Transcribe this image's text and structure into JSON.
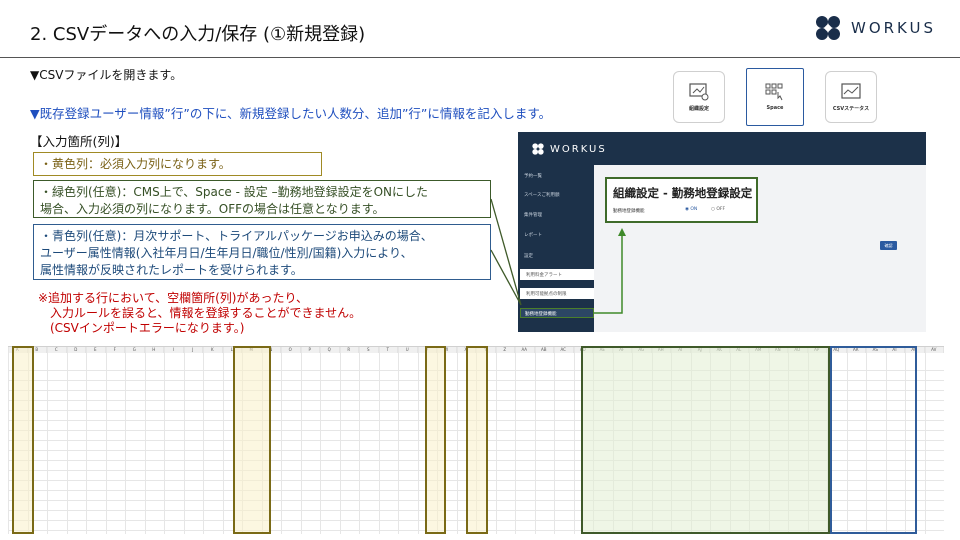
{
  "slide": {
    "title": "2. CSVデータへの入力/保存 (①新規登録)",
    "logo_text": "WORKUS"
  },
  "instructions": {
    "line1": "▼CSVファイルを開きます。",
    "line2": "▼既存登録ユーザー情報”行”の下に、新規登録したい人数分、追加”行”に情報を記入します。",
    "section_label": "【入力箇所(列)】"
  },
  "legend": {
    "yellow": "・黄色列：必須入力列になります。",
    "green": [
      "・緑色列(任意)：CMS上で、Space - 設定 –勤務地登録設定をONにした",
      "場合、入力必須の列になります。OFFの場合は任意となります。"
    ],
    "blue": [
      "・青色列(任意)：月次サポート、トライアルパッケージお申込みの場合、",
      "ユーザー属性情報(入社年月日/生年月日/職位/性別/国籍)入力により、",
      "属性情報が反映されたレポートを受けられます。"
    ]
  },
  "note": [
    "※追加する行において、空欄箇所(列)があったり、",
    "　入力ルールを誤ると、情報を登録することができません。",
    "　(CSVインポートエラーになります。)"
  ],
  "menu_icons": [
    {
      "label": "組織設定",
      "icon": "org-settings-icon",
      "selected": false
    },
    {
      "label": "Space",
      "icon": "space-icon",
      "selected": true
    },
    {
      "label": "CSVステータス",
      "icon": "csv-status-icon",
      "selected": false
    }
  ],
  "screenshot": {
    "logo_text": "WORKUS",
    "sidebar": [
      "予約一覧",
      "スペースご利用額",
      "集件管理",
      "レポート",
      "設定"
    ],
    "sub_items": [
      "利用料金アラート",
      "利用可能拠点の制限"
    ],
    "active_item": "勤務地登録機能",
    "heading": "組織設定 - 勤務地登録設定",
    "field_label": "勤務地登録機能",
    "radio_on": "ON",
    "radio_off": "OFF",
    "confirm_button": "確認"
  },
  "sheet": {
    "columns": [
      "A",
      "B",
      "C",
      "D",
      "E",
      "F",
      "G",
      "H",
      "I",
      "J",
      "K",
      "L",
      "M",
      "N",
      "O",
      "P",
      "Q",
      "R",
      "S",
      "T",
      "U",
      "V",
      "W",
      "X",
      "Y",
      "Z",
      "AA",
      "AB",
      "AC",
      "AD",
      "AE",
      "AF",
      "AG",
      "AH",
      "AI",
      "AJ",
      "AK",
      "AL",
      "AM",
      "AN",
      "AO",
      "AP",
      "AQ",
      "AR",
      "AS",
      "AT",
      "AU",
      "AV"
    ]
  },
  "colors": {
    "yellow_border": "#7a6a16",
    "green_border": "#3f5a2a",
    "blue_border": "#2f5c9a",
    "note_red": "#c00000",
    "link_blue": "#1f4fbf"
  }
}
